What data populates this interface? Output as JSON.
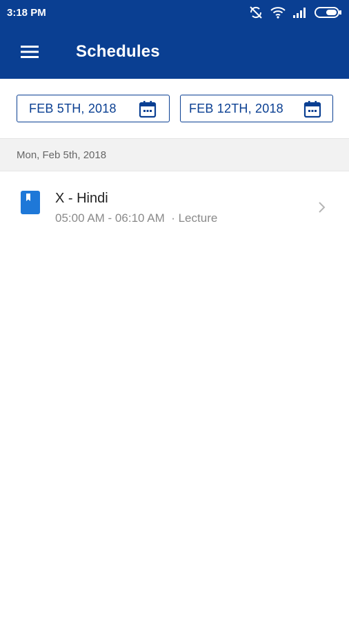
{
  "status_bar": {
    "time": "3:18 PM"
  },
  "app_bar": {
    "title": "Schedules"
  },
  "date_range": {
    "start": "FEB 5TH, 2018",
    "end": "FEB 12TH, 2018"
  },
  "section": {
    "date_label": "Mon, Feb 5th, 2018"
  },
  "schedule_items": [
    {
      "title": "X - Hindi",
      "time": "05:00 AM - 06:10 AM",
      "type": "· Lecture"
    }
  ],
  "colors": {
    "primary": "#0a3f92",
    "icon_blue": "#1e78d8",
    "header_bg": "#f2f2f2"
  }
}
